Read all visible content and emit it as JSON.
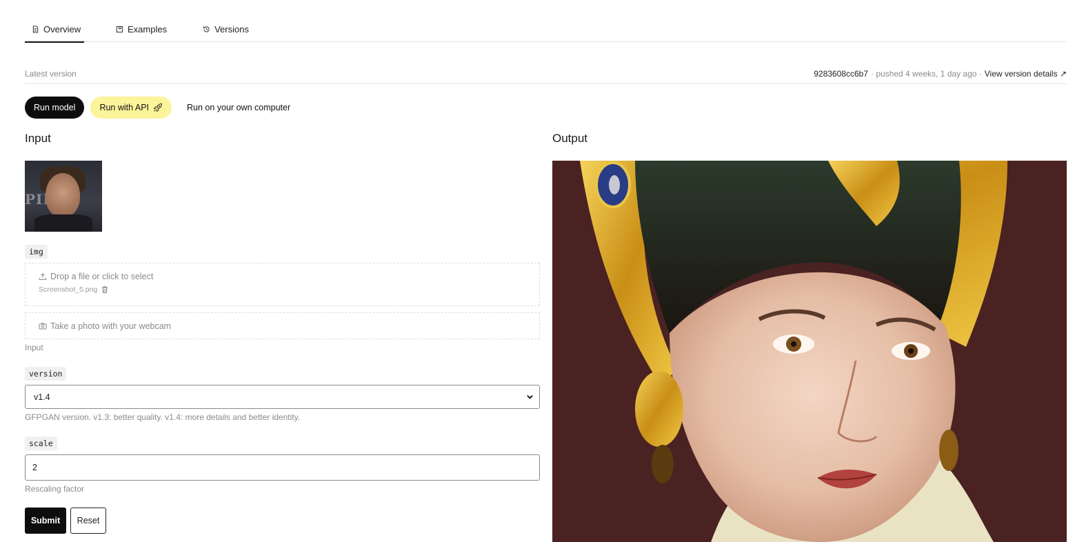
{
  "tabs": [
    {
      "label": "Overview",
      "icon": "document-icon",
      "active": true
    },
    {
      "label": "Examples",
      "icon": "bookmark-icon",
      "active": false
    },
    {
      "label": "Versions",
      "icon": "history-icon",
      "active": false
    }
  ],
  "version_bar": {
    "label": "Latest version",
    "hash": "9283608cc6b7",
    "pushed": "· pushed 4 weeks, 1 day ago ·",
    "details_link": "View version details"
  },
  "run_buttons": {
    "run_model": "Run model",
    "run_api": "Run with API",
    "run_local": "Run on your own computer"
  },
  "input": {
    "heading": "Input",
    "img_tag": "img",
    "drop_text": "Drop a file or click to select",
    "file_name": "Screenshot_5.png",
    "webcam_text": "Take a photo with your webcam",
    "img_help": "Input",
    "version_tag": "version",
    "version_value": "v1.4",
    "version_help": "GFPGAN version. v1.3: better quality. v1.4: more details and better identity.",
    "scale_tag": "scale",
    "scale_value": "2",
    "scale_help": "Rescaling factor",
    "submit": "Submit",
    "reset": "Reset"
  },
  "output": {
    "heading": "Output"
  },
  "colors": {
    "accent_yellow": "#fbf49a",
    "dark": "#0d0d0d",
    "output_bg": "#4a2222"
  }
}
